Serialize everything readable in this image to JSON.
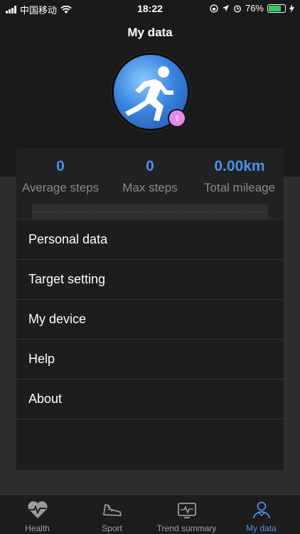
{
  "status_bar": {
    "carrier": "中国移动",
    "time": "18:22",
    "battery": "76%",
    "battery_level": 0.76
  },
  "header": {
    "title": "My data"
  },
  "stats": [
    {
      "value": "0",
      "label": "Average steps"
    },
    {
      "value": "0",
      "label": "Max steps"
    },
    {
      "value": "0.00km",
      "label": "Total mileage"
    }
  ],
  "menu": {
    "items": [
      {
        "label": "Personal data"
      },
      {
        "label": "Target setting"
      },
      {
        "label": "My device"
      },
      {
        "label": "Help"
      },
      {
        "label": "About"
      }
    ]
  },
  "bottom_nav": {
    "items": [
      {
        "label": "Health",
        "icon": "heart-pulse-icon"
      },
      {
        "label": "Sport",
        "icon": "shoe-icon"
      },
      {
        "label": "Trend summary",
        "icon": "monitor-pulse-icon"
      },
      {
        "label": "My data",
        "icon": "person-icon",
        "active": true
      }
    ]
  },
  "colors": {
    "accent": "#4a90e8",
    "background": "#2e2e2e",
    "badge": "#e38ce8"
  }
}
